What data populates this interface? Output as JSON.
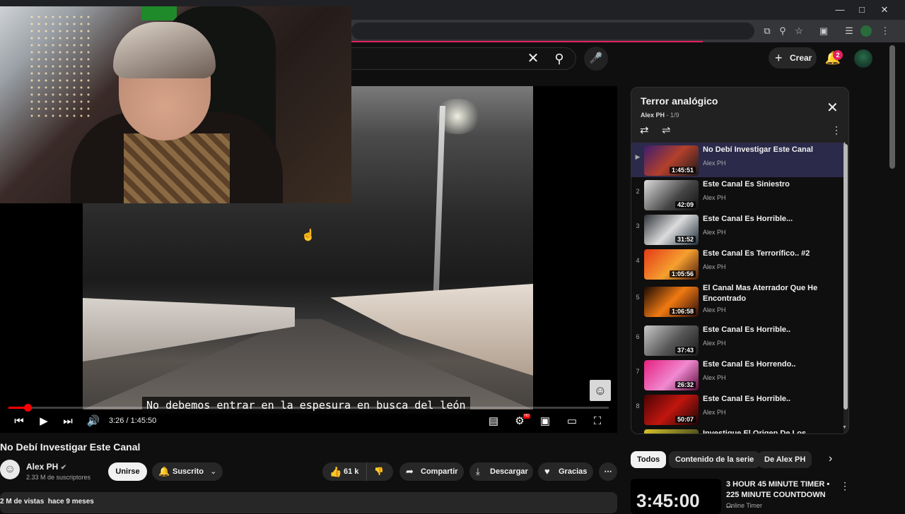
{
  "masthead": {
    "create_label": "Crear",
    "notifications_count": "2"
  },
  "player": {
    "subtitle": "No debemos entrar en la espesura en busca del león",
    "current_time": "3:26",
    "duration": "1:45:50",
    "time_display": "3:26 / 1:45:50",
    "progress_fraction": 0.032
  },
  "video": {
    "title": "No Debí Investigar Este Canal",
    "channel_name": "Alex PH",
    "subscribers": "2.33 M de suscriptores",
    "join_label": "Unirse",
    "subscribed_label": "Suscrito",
    "likes": "61 k",
    "share_label": "Compartir",
    "download_label": "Descargar",
    "thanks_label": "Gracias",
    "views_meta": "2 M de vistas  hace 9 meses"
  },
  "playlist": {
    "title": "Terror analógico",
    "owner": "Alex PH",
    "position": "1/9",
    "items": [
      {
        "index": "▶",
        "title": "No Debí Investigar Este Canal",
        "channel": "Alex PH",
        "duration": "1:45:51",
        "active": true
      },
      {
        "index": "2",
        "title": "Este Canal Es Siniestro",
        "channel": "Alex PH",
        "duration": "42:09"
      },
      {
        "index": "3",
        "title": "Este Canal Es Horrible...",
        "channel": "Alex PH",
        "duration": "31:52"
      },
      {
        "index": "4",
        "title": "Este Canal Es Terrorífico.. #2",
        "channel": "Alex PH",
        "duration": "1:05:56"
      },
      {
        "index": "5",
        "title": "El Canal Mas Aterrador Que He Encontrado",
        "channel": "Alex PH",
        "duration": "1:06:58"
      },
      {
        "index": "6",
        "title": "Este Canal Es Horrible..",
        "channel": "Alex PH",
        "duration": "37:43"
      },
      {
        "index": "7",
        "title": "Este Canal Es Horrendo..",
        "channel": "Alex PH",
        "duration": "26:32"
      },
      {
        "index": "8",
        "title": "Este Canal Es Horrible..",
        "channel": "Alex PH",
        "duration": "50:07"
      },
      {
        "index": "",
        "title": "Investigue El Origen De Los",
        "channel": "",
        "duration": ""
      }
    ]
  },
  "chips": [
    "Todos",
    "Contenido de la serie",
    "De Alex PH"
  ],
  "recommendation": {
    "thumb_text": "3:45:00",
    "title": "3 HOUR 45 MINUTE TIMER • 225 MINUTE COUNTDOWN ...",
    "channel": "Online Timer"
  },
  "colors": {
    "accent_red": "#ff0000",
    "notification_badge": "#e5205f",
    "active_playlist_row": "#2c2a4a"
  }
}
